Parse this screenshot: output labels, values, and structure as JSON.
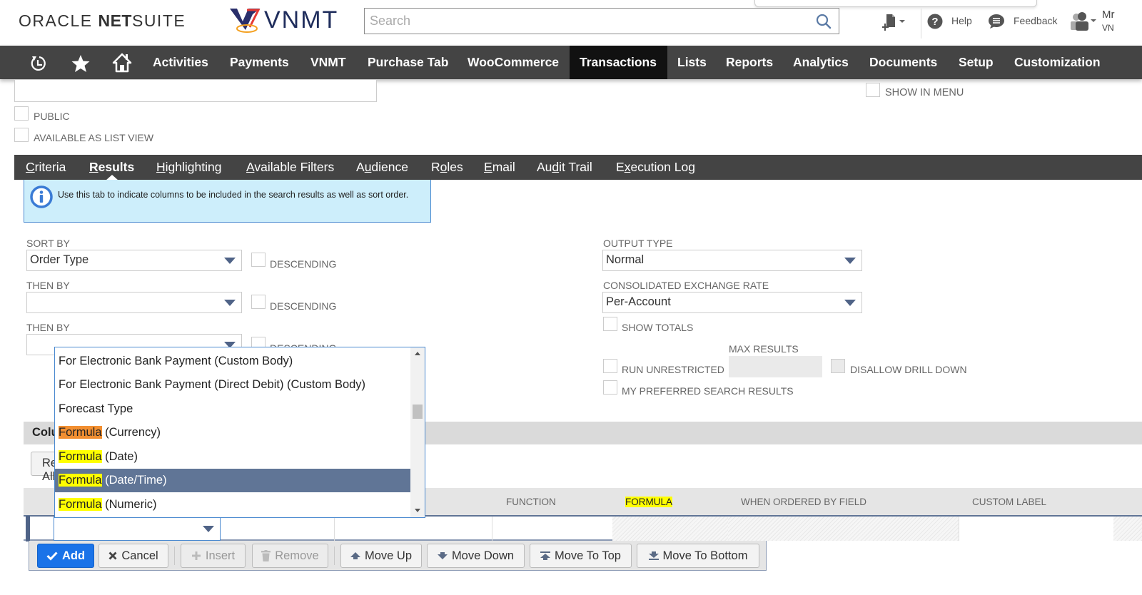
{
  "header": {
    "oracle_logo": {
      "bold1": "ORACLE ",
      "bold2": "NET",
      "light": "SUITE"
    },
    "company_logo": "VNMT",
    "search": {
      "placeholder": "Search",
      "value": ""
    },
    "help_label": "Help",
    "feedback_label": "Feedback",
    "user": {
      "name": "Mr",
      "company": "VN"
    }
  },
  "nav": {
    "items": [
      {
        "label": "Activities"
      },
      {
        "label": "Payments"
      },
      {
        "label": "VNMT"
      },
      {
        "label": "Purchase Tab"
      },
      {
        "label": "WooCommerce"
      },
      {
        "label": "Transactions",
        "active": true
      },
      {
        "label": "Lists"
      },
      {
        "label": "Reports"
      },
      {
        "label": "Analytics"
      },
      {
        "label": "Documents"
      },
      {
        "label": "Setup"
      },
      {
        "label": "Customization"
      }
    ]
  },
  "form": {
    "public_label": "PUBLIC",
    "available_list_view_label": "AVAILABLE AS LIST VIEW",
    "show_in_menu_label": "SHOW IN MENU"
  },
  "subtabs": {
    "items": [
      {
        "pre": "",
        "key": "C",
        "post": "riteria"
      },
      {
        "pre": "",
        "key": "R",
        "post": "esults",
        "active": true
      },
      {
        "pre": "",
        "key": "H",
        "post": "ighlighting"
      },
      {
        "pre": "",
        "key": "A",
        "post": "vailable Filters"
      },
      {
        "pre": "A",
        "key": "u",
        "post": "dience"
      },
      {
        "pre": "R",
        "key": "o",
        "post": "les"
      },
      {
        "pre": "",
        "key": "E",
        "post": "mail"
      },
      {
        "pre": "Au",
        "key": "d",
        "post": "it Trail"
      },
      {
        "pre": "E",
        "key": "x",
        "post": "ecution Log"
      }
    ]
  },
  "results": {
    "info_text": "Use this tab to indicate columns to be included in the search results as well as sort order.",
    "sort_by_label": "SORT BY",
    "sort_by_value": "Order Type",
    "then_by_label": "THEN BY",
    "then_by_1_value": "",
    "then_by_2_value": "",
    "descending_label": "DESCENDING",
    "output_type_label": "OUTPUT TYPE",
    "output_type_value": "Normal",
    "exchange_rate_label": "CONSOLIDATED EXCHANGE RATE",
    "exchange_rate_value": "Per-Account",
    "show_totals_label": "SHOW TOTALS",
    "max_results_label": "MAX RESULTS",
    "max_results_value": "",
    "run_unrestricted_label": "RUN UNRESTRICTED",
    "disallow_drill_down_label": "DISALLOW DRILL DOWN",
    "my_preferred_label": "MY PREFERRED SEARCH RESULTS"
  },
  "dropdown": {
    "items": [
      {
        "hl": "",
        "rest": "For Electronic Bank Payment (Custom Body)"
      },
      {
        "hl": "",
        "rest": "For Electronic Bank Payment (Direct Debit) (Custom Body)"
      },
      {
        "hl": "",
        "rest": "Forecast Type"
      },
      {
        "hl": "Formula",
        "hl_color": "orange",
        "rest": " (Currency)"
      },
      {
        "hl": "Formula",
        "hl_color": "yellow",
        "rest": " (Date)"
      },
      {
        "hl": "Formula",
        "hl_color": "yellow",
        "rest": " (Date/Time)",
        "selected": true
      },
      {
        "hl": "Formula",
        "hl_color": "yellow",
        "rest": " (Numeric)"
      }
    ]
  },
  "columns": {
    "section_title": "Columns",
    "remove_all_label": "Remove All",
    "headers": [
      "FUNCTION",
      "FORMULA",
      "WHEN ORDERED BY FIELD",
      "CUSTOM LABEL"
    ],
    "buttons": {
      "add": "Add",
      "cancel": "Cancel",
      "insert": "Insert",
      "remove": "Remove",
      "move_up": "Move Up",
      "move_down": "Move Down",
      "move_to_top": "Move To Top",
      "move_to_bottom": "Move To Bottom"
    }
  },
  "colors": {
    "nav_bg": "#444444",
    "nav_active": "#111111",
    "primary_button": "#1a73e8",
    "selected_row": "#607596",
    "highlight_yellow": "#ffff00",
    "highlight_orange": "#f28f31",
    "info_bg": "#cdeefb"
  }
}
